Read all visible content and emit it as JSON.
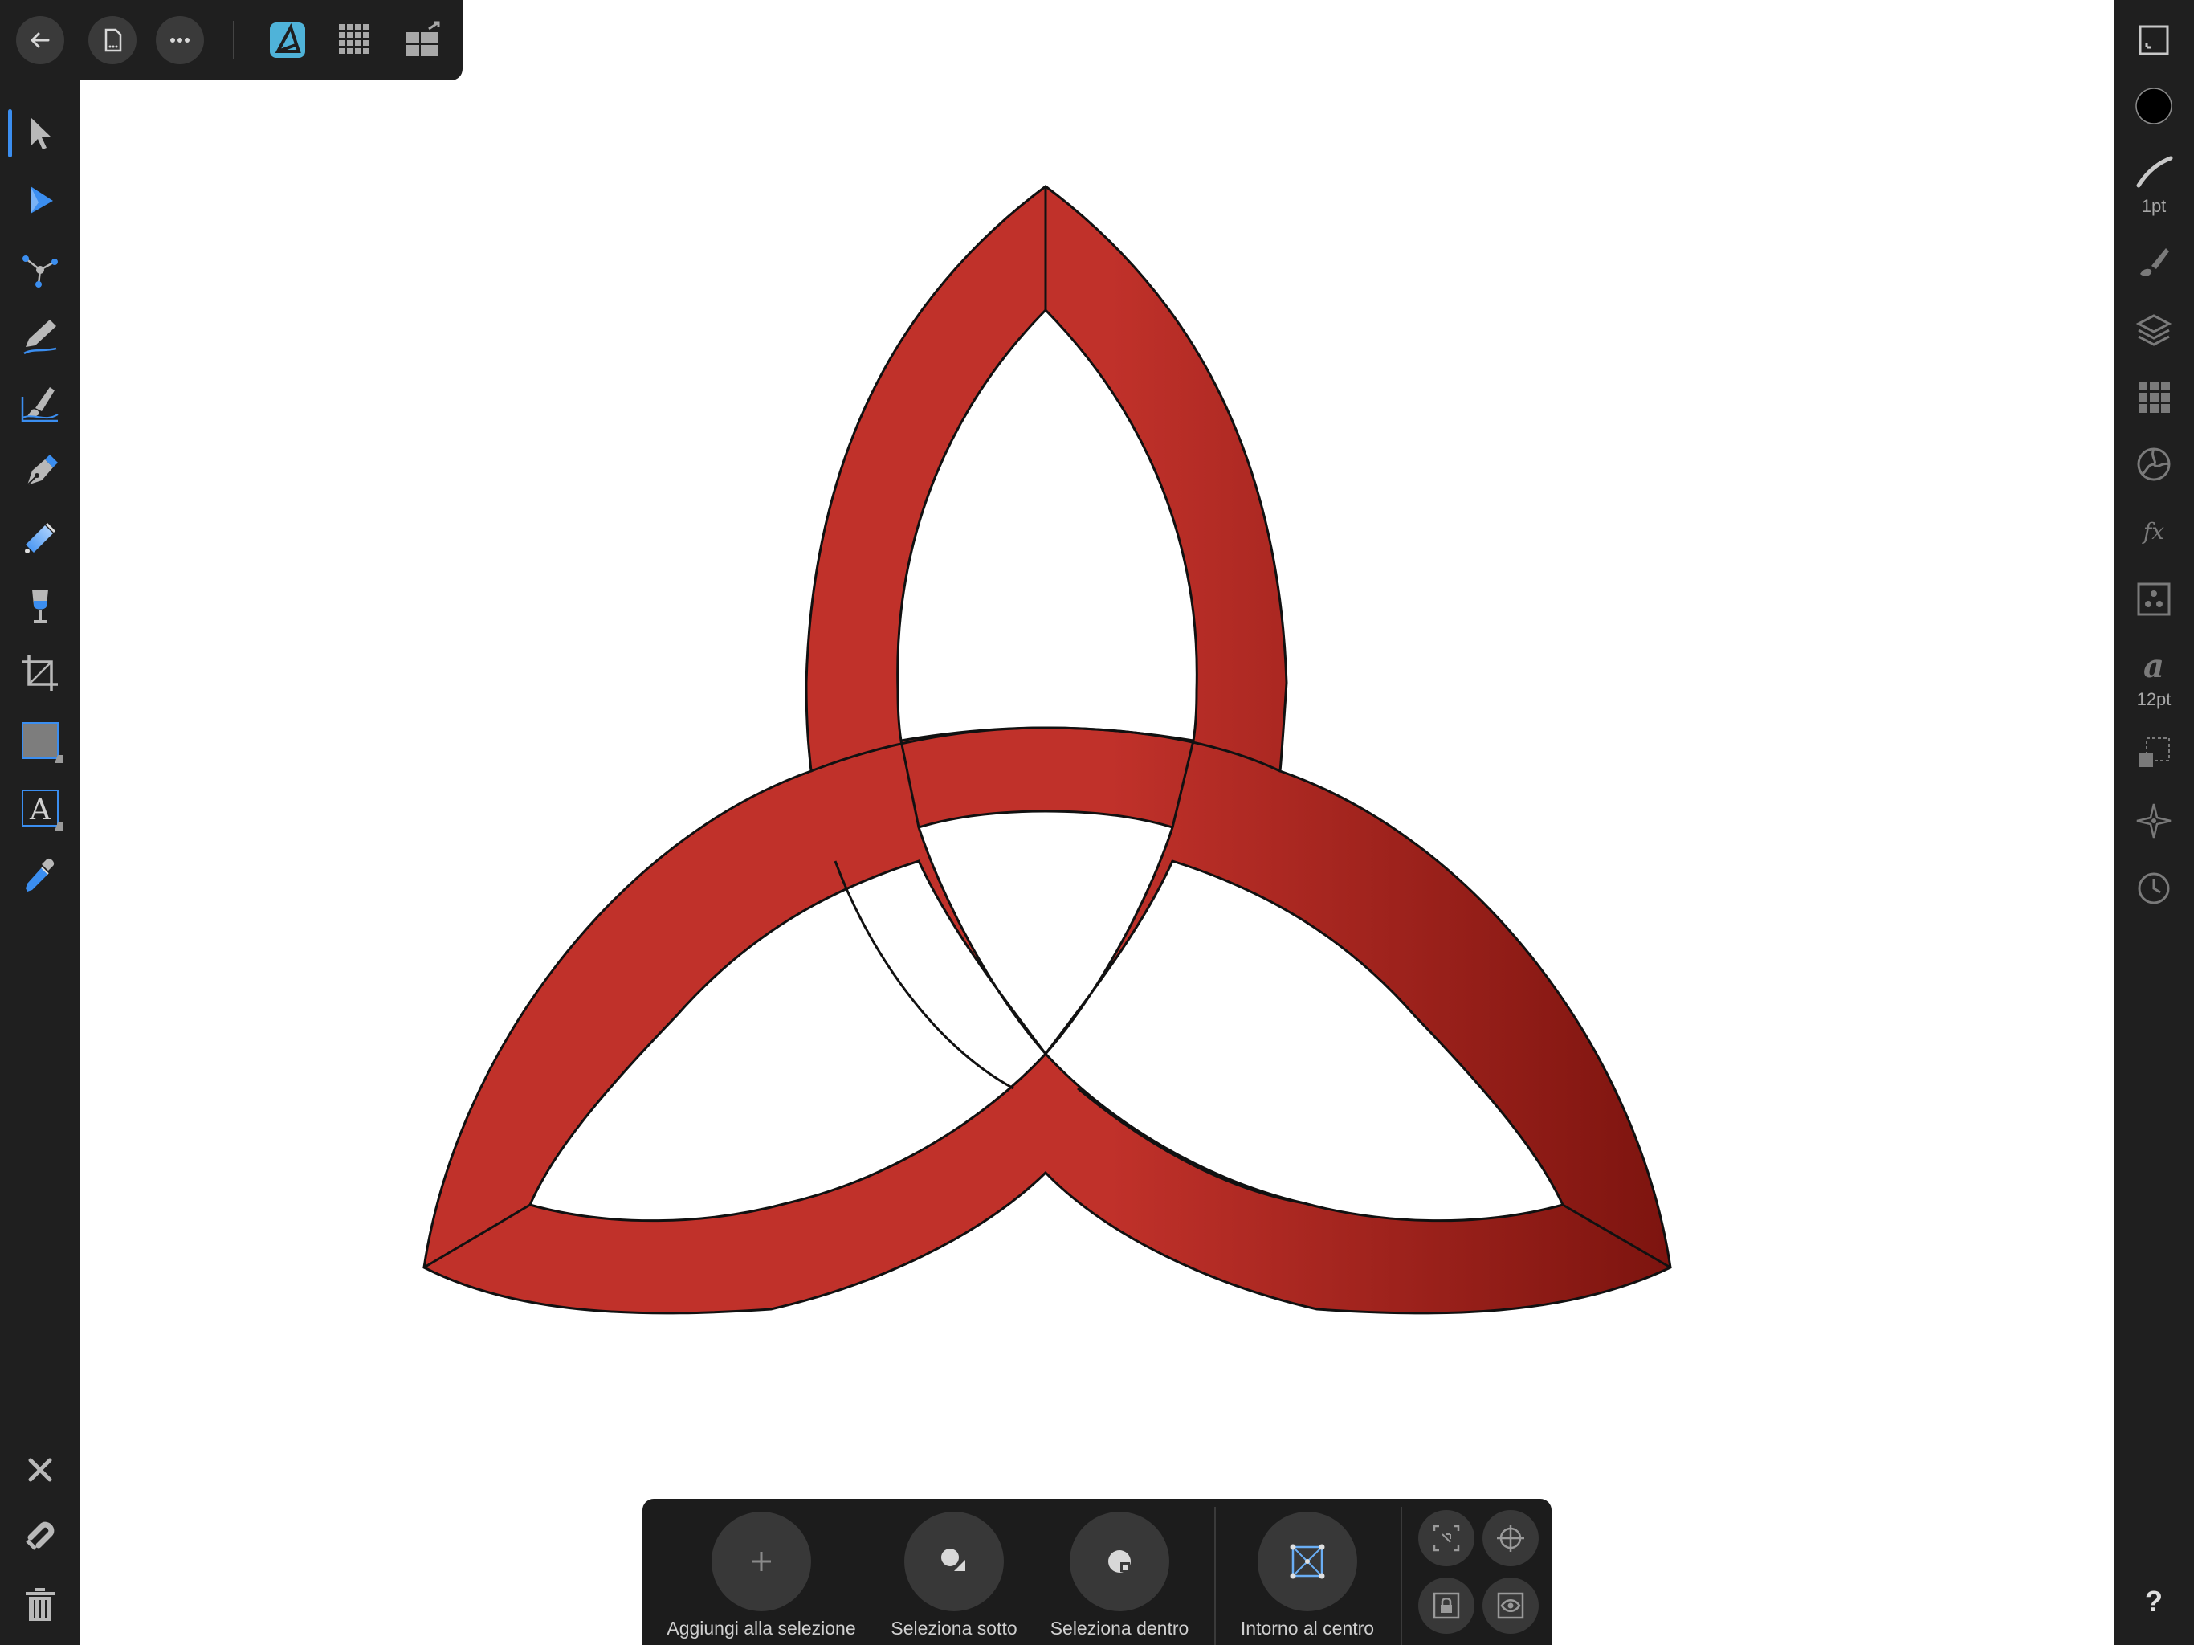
{
  "top_toolbar": {
    "back_icon": "arrow-left-icon",
    "document_icon": "document-icon",
    "more_icon": "ellipsis-icon",
    "persona_icons": [
      "designer-persona-icon",
      "pixel-persona-icon",
      "export-persona-icon"
    ]
  },
  "left_tools": [
    {
      "name": "move-tool",
      "icon": "arrow-cursor-icon"
    },
    {
      "name": "node-tool",
      "icon": "node-cursor-icon"
    },
    {
      "name": "corner-tool",
      "icon": "corner-icon"
    },
    {
      "name": "pencil-tool",
      "icon": "pencil-icon"
    },
    {
      "name": "vector-brush-tool",
      "icon": "vector-brush-icon"
    },
    {
      "name": "pen-tool",
      "icon": "pen-nib-icon"
    },
    {
      "name": "fill-tool",
      "icon": "gradient-fill-icon"
    },
    {
      "name": "transparency-tool",
      "icon": "transparency-icon"
    },
    {
      "name": "crop-tool",
      "icon": "crop-icon"
    },
    {
      "name": "rectangle-tool",
      "icon": "rectangle-icon"
    },
    {
      "name": "artistic-text-tool",
      "icon": "text-icon"
    },
    {
      "name": "color-picker-tool",
      "icon": "eyedropper-icon"
    }
  ],
  "left_bottom": {
    "close_icon": "close-icon",
    "snap_icon": "magnet-icon",
    "delete_icon": "trash-icon"
  },
  "right_panel": {
    "stroke_width_label": "1pt",
    "font_size_label": "12pt",
    "help_label": "?",
    "fill_color": "#000000"
  },
  "artwork": {
    "stroke_color": "#111111",
    "fill_colors": [
      "#c0312a",
      "#7d140f"
    ]
  },
  "context_toolbar": {
    "add_to_selection": "Aggiungi alla selezione",
    "select_under": "Seleziona sotto",
    "select_inside": "Seleziona dentro",
    "around_center": "Intorno al centro"
  }
}
